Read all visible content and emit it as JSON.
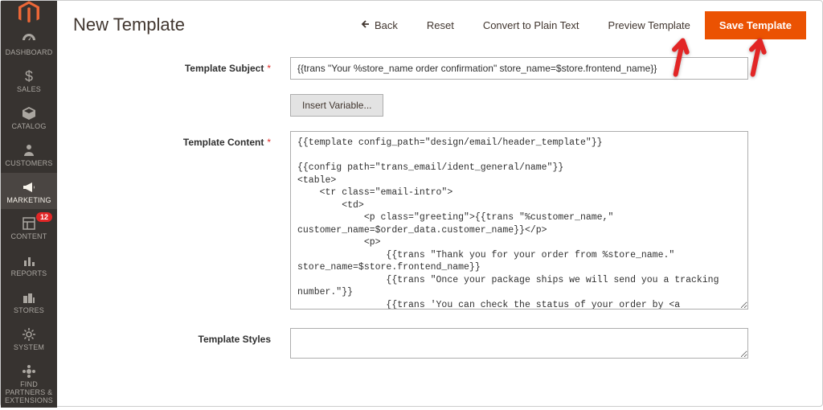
{
  "sidebar": {
    "items": [
      {
        "label": "DASHBOARD",
        "icon": "dashboard-icon"
      },
      {
        "label": "SALES",
        "icon": "dollar-icon"
      },
      {
        "label": "CATALOG",
        "icon": "box-icon"
      },
      {
        "label": "CUSTOMERS",
        "icon": "person-icon"
      },
      {
        "label": "MARKETING",
        "icon": "megaphone-icon"
      },
      {
        "label": "CONTENT",
        "icon": "layout-icon",
        "badge": "12"
      },
      {
        "label": "REPORTS",
        "icon": "bars-icon"
      },
      {
        "label": "STORES",
        "icon": "stores-icon"
      },
      {
        "label": "SYSTEM",
        "icon": "gear-icon"
      },
      {
        "label": "FIND PARTNERS & EXTENSIONS",
        "icon": "partners-icon"
      }
    ]
  },
  "header": {
    "title": "New Template",
    "back": "Back",
    "reset": "Reset",
    "convert": "Convert to Plain Text",
    "preview": "Preview Template",
    "save": "Save Template"
  },
  "form": {
    "subject_label": "Template Subject",
    "subject_value": "{{trans \"Your %store_name order confirmation\" store_name=$store.frontend_name}}",
    "insert_variable": "Insert Variable...",
    "content_label": "Template Content",
    "content_value": "{{template config_path=\"design/email/header_template\"}}\n\n{{config path=\"trans_email/ident_general/name\"}}\n<table>\n    <tr class=\"email-intro\">\n        <td>\n            <p class=\"greeting\">{{trans \"%customer_name,\" customer_name=$order_data.customer_name}}</p>\n            <p>\n                {{trans \"Thank you for your order from %store_name.\" store_name=$store.frontend_name}}\n                {{trans \"Once your package ships we will send you a tracking number.\"}}\n                {{trans 'You can check the status of your order by <a href=\"%account_url\">logging into your account</a>.' account_url=$this.getUrl($store,'customer/account/',[_nosid:1]) |raw}}\n            </p>\n            <p>\n                {{trans 'If you have questions about your order, you can email us at <a href=\"mailto:%store_email\">%store_email</a>' store_email=$store_email |raw}}{{depend store_phone}} {{trans 'or call us at <a href=\"tel:%store_phone\">%store_phone</a>' store_phone=$store_phone |raw}}{{/depend}}.",
    "styles_label": "Template Styles",
    "styles_value": ""
  }
}
